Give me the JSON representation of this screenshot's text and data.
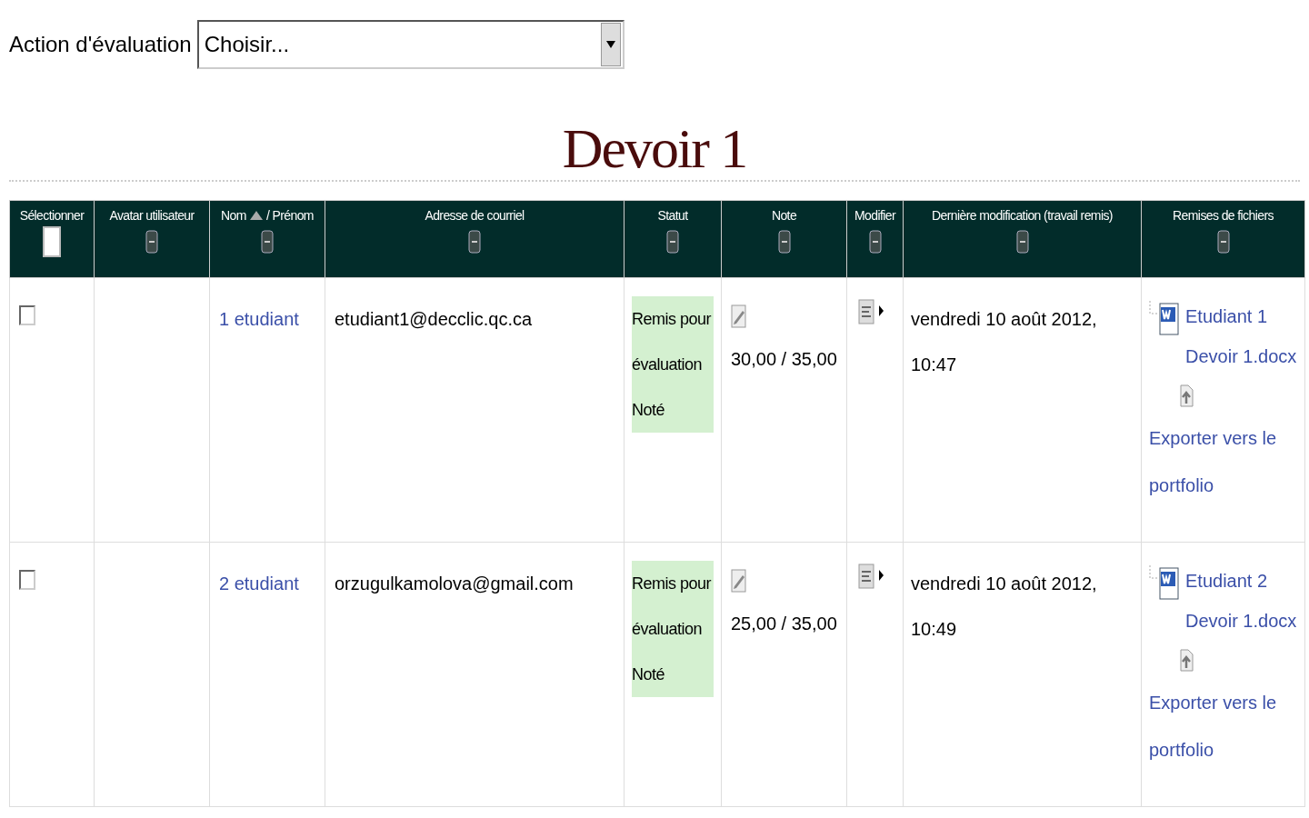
{
  "action": {
    "label": "Action d'évaluation",
    "select": {
      "value": "Choisir..."
    }
  },
  "title": "Devoir 1",
  "table": {
    "columns": [
      {
        "kind": "checkbox",
        "label": "Sélectionner",
        "checked": false
      },
      {
        "kind": "text",
        "label": "Avatar utilisateur"
      },
      {
        "kind": "sortable",
        "label": "Nom",
        "label_2": "/ Prénom",
        "sorted": true
      },
      {
        "kind": "text",
        "label": "Adresse de courriel"
      },
      {
        "kind": "text",
        "label": "Statut"
      },
      {
        "kind": "text",
        "label": "Note"
      },
      {
        "kind": "text",
        "label": "Modifier"
      },
      {
        "kind": "text",
        "label": "Dernière modification (travail remis)"
      },
      {
        "kind": "text",
        "label": "Remises de fichiers"
      }
    ],
    "rows": [
      {
        "selected": false,
        "name": "1 etudiant",
        "email": "etudiant1@decclic.qc.ca",
        "status": "Remis pour évaluation",
        "grading": "Noté",
        "grade": "30,00 / 35,00",
        "modified": "vendredi 10 août 2012, 10:47",
        "file": "Etudiant 1 Devoir 1.docx",
        "export": "Exporter vers le portfolio"
      },
      {
        "selected": false,
        "name": "2 etudiant",
        "email": "orzugulkamolova@gmail.com",
        "status": "Remis pour évaluation",
        "grading": "Noté",
        "grade": "25,00 / 35,00",
        "modified": "vendredi 10 août 2012, 10:49",
        "file": "Etudiant 2 Devoir 1.docx",
        "export": "Exporter vers le portfolio"
      }
    ]
  }
}
